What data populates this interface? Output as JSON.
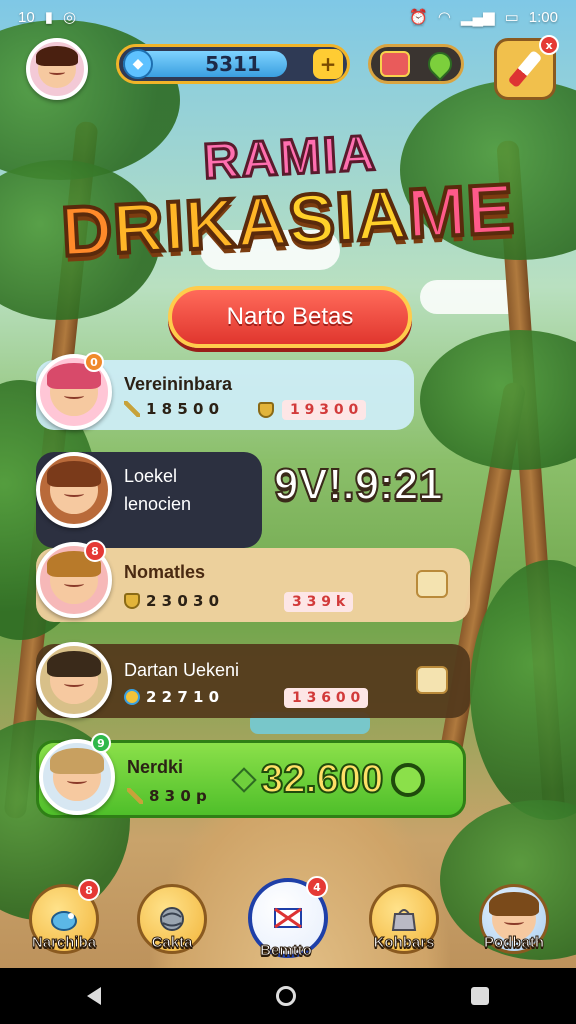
{
  "status_bar": {
    "left_text": "10",
    "time": "1:00"
  },
  "hud": {
    "currency_amount": "5311",
    "currency_fill": 0.72,
    "plus_label": "+",
    "tool_badge": "x"
  },
  "title": {
    "line1": "RAMIA",
    "line2_parts": [
      "D",
      "RIKA",
      "SIA",
      "ME"
    ]
  },
  "cta_label": "Narto Betas",
  "leaderboard": [
    {
      "name": "Vereininbara",
      "stat": "1 8 5 0 0",
      "shield_value": "1 9 3 0 0",
      "badge": "0"
    },
    {
      "name": "Loekel",
      "sub": "lenocien",
      "timer": "9V!.9:21"
    },
    {
      "name": "Nomatles",
      "stat": "2 3 0 3 0",
      "score": "3 3 9 k",
      "badge": "8"
    },
    {
      "name": "Dartan Uekeni",
      "stat": "2 2 7 1 0",
      "score": "1 3 6 0 0"
    },
    {
      "name": "Nerdki",
      "stat": "8 3 0 p",
      "big_score": "32.600",
      "badge": "9"
    }
  ],
  "nav": [
    {
      "label": "Narchiba",
      "badge": "8",
      "icon": "bird-icon"
    },
    {
      "label": "Cakta",
      "icon": "globe-icon"
    },
    {
      "label": "Bemtto",
      "badge": "4",
      "icon": "mail-icon",
      "active": true
    },
    {
      "label": "Kohbars",
      "icon": "bag-icon"
    },
    {
      "label": "Podbath",
      "icon": "profile-icon"
    }
  ],
  "colors": {
    "accent": "#f0b429",
    "cta": "#e0362e",
    "highlight_row": "#4fbf2a"
  }
}
